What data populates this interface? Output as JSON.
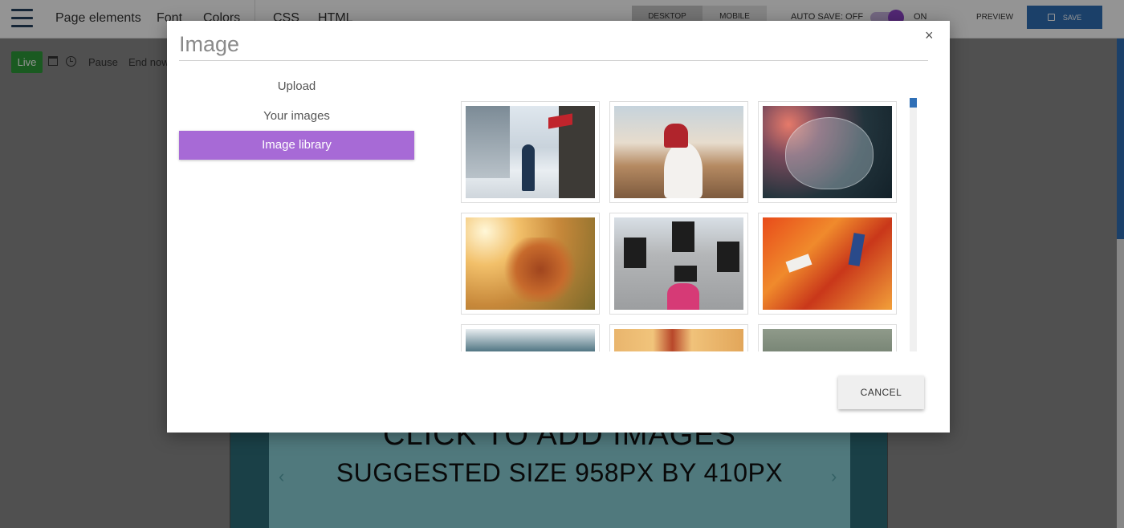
{
  "topbar": {
    "menu": [
      "Page elements",
      "Font",
      "Colors",
      "CSS",
      "HTML"
    ],
    "view_desktop": "DESKTOP",
    "view_mobile": "MOBILE",
    "autosave_label": "AUTO SAVE: OFF",
    "toggle_label": "ON",
    "preview_label": "PREVIEW",
    "save_label": "SAVE"
  },
  "subbar": {
    "live_label": "Live",
    "pause_label": "Pause",
    "end_label": "End now"
  },
  "canvas": {
    "line1": "CLICK TO ADD IMAGES",
    "line2": "SUGGESTED SIZE 958PX  BY 410PX"
  },
  "modal": {
    "title": "Image",
    "close_symbol": "×",
    "tabs": [
      {
        "label": "Upload",
        "active": false
      },
      {
        "label": "Your images",
        "active": false
      },
      {
        "label": "Image library",
        "active": true
      }
    ],
    "images": [
      {
        "name": "woman-snowy-street-photo"
      },
      {
        "name": "couple-kissing-canyon-photo"
      },
      {
        "name": "person-umbrella-photo"
      },
      {
        "name": "woman-windblown-hair-photo"
      },
      {
        "name": "woman-brick-building-photo"
      },
      {
        "name": "abstract-orange-paint-photo"
      },
      {
        "name": "snowy-mountain-photo"
      },
      {
        "name": "apartment-facade-photo"
      },
      {
        "name": "tree-branches-photo"
      }
    ],
    "cancel_label": "CANCEL"
  },
  "colors": {
    "accent_purple": "#a76ad6",
    "live_green": "#2e9b3a",
    "save_blue": "#2f6fb6"
  }
}
